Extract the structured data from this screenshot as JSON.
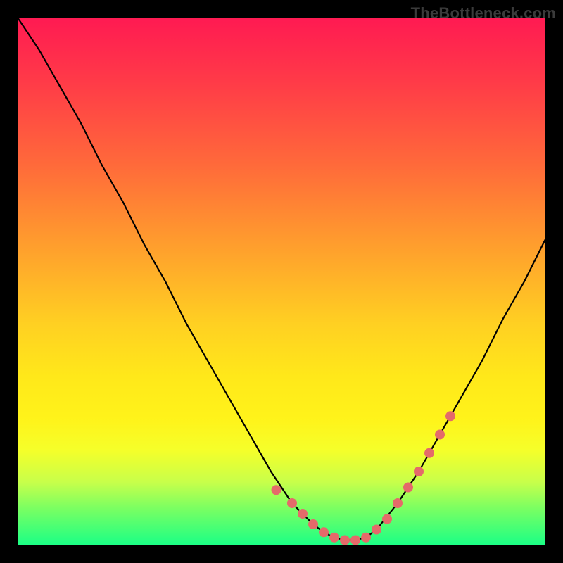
{
  "watermark": "TheBottleneck.com",
  "chart_data": {
    "type": "line",
    "title": "",
    "xlabel": "",
    "ylabel": "",
    "xlim": [
      0,
      100
    ],
    "ylim": [
      0,
      100
    ],
    "grid": false,
    "legend": false,
    "series": [
      {
        "name": "bottleneck-curve",
        "color": "#000000",
        "x": [
          0,
          4,
          8,
          12,
          16,
          20,
          24,
          28,
          32,
          36,
          40,
          44,
          48,
          52,
          56,
          58,
          60,
          62,
          64,
          66,
          68,
          72,
          76,
          80,
          84,
          88,
          92,
          96,
          100
        ],
        "y": [
          100,
          94,
          87,
          80,
          72,
          65,
          57,
          50,
          42,
          35,
          28,
          21,
          14,
          8,
          4,
          2.5,
          1.5,
          1,
          1,
          1.5,
          3,
          8,
          14,
          21,
          28,
          35,
          43,
          50,
          58
        ]
      }
    ],
    "markers": {
      "name": "highlight-dots",
      "color": "#e46a6a",
      "radius_px": 7,
      "x": [
        49,
        52,
        54,
        56,
        58,
        60,
        62,
        64,
        66,
        68,
        70,
        72,
        74,
        76,
        78,
        80,
        82
      ],
      "y": [
        10.5,
        8,
        6,
        4,
        2.5,
        1.5,
        1,
        1,
        1.5,
        3,
        5,
        8,
        11,
        14,
        17.5,
        21,
        24.5
      ]
    }
  }
}
